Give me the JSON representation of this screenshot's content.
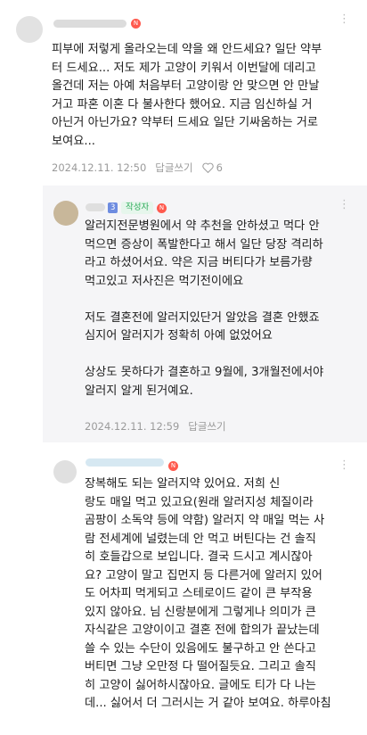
{
  "comments": [
    {
      "text": "피부에 저렇게 올라오는데 약을 왜 안드세요? 일단 약부\n터 드세요... 저도 제가 고양이 키워서 이번달에 데리고\n올건데 저는 아예 처음부터 고양이랑 안 맞으면 안 만날\n거고 파혼 이혼 다 불사한다 했어요. 지금 임신하실 거\n아닌거 아닌가요? 약부터 드세요 일단 기싸움하는 거로\n보여요...",
      "date": "2024.12.11. 12:50",
      "reply": "답글쓰기",
      "likes": "6"
    },
    {
      "level_badge": "3",
      "author_tag": "작성자",
      "text": "알러지전문병원에서 약 추천을 안하셨고 먹다 안\n먹으면 증상이 폭발한다고 해서 일단 당장 격리하\n라고 하셨어서요. 약은 지금 버티다가 보름가량\n먹고있고 저사진은 먹기전이에요\n\n저도 결혼전에 알러지있단거 알았음 결혼 안했죠\n심지어 알러지가 정확히 아예 없었어요\n\n상상도 못하다가 결혼하고 9월에, 3개월전에서야\n알러지 알게 된거예요.",
      "date": "2024.12.11. 12:59",
      "reply": "답글쓰기"
    },
    {
      "text": "장복해도 되는 알러지약 있어요. 저희 신\n랑도 매일 먹고 있고요(원래 알러지성 체질이라\n곰팡이 소독약 등에 약함) 알러지 약 매일 먹는 사\n람 전세계에 널렸는데 안 먹고 버틴다는 건 솔직\n히 호들갑으로 보입니다. 결국 드시고 계시잖아\n요? 고양이 말고 집먼지 등 다른거에 알러지 있어\n도 어차피 먹게되고 스테로이드 같이 큰 부작용\n있지 않아요. 님 신랑분에게 그렇게나 의미가 큰\n자식같은 고양이이고 결혼 전에 합의가 끝났는데\n쓸 수 있는 수단이 있음에도 불구하고 안 쓴다고\n버티면 그냥 오만정 다 떨어질듯요. 그리고 솔직\n히 고양이 싫어하시잖아요. 글에도 티가 다 나는\n데... 싫어서 더 그러시는 거 같아 보여요. 하루아침"
    }
  ],
  "icons": {
    "badge": "N",
    "more": "⋮",
    "heart": "heart-icon"
  },
  "colors": {
    "badge_red": "#ff5a4e",
    "author_green": "#2eab5a",
    "level_blue": "#6e8ce0"
  }
}
